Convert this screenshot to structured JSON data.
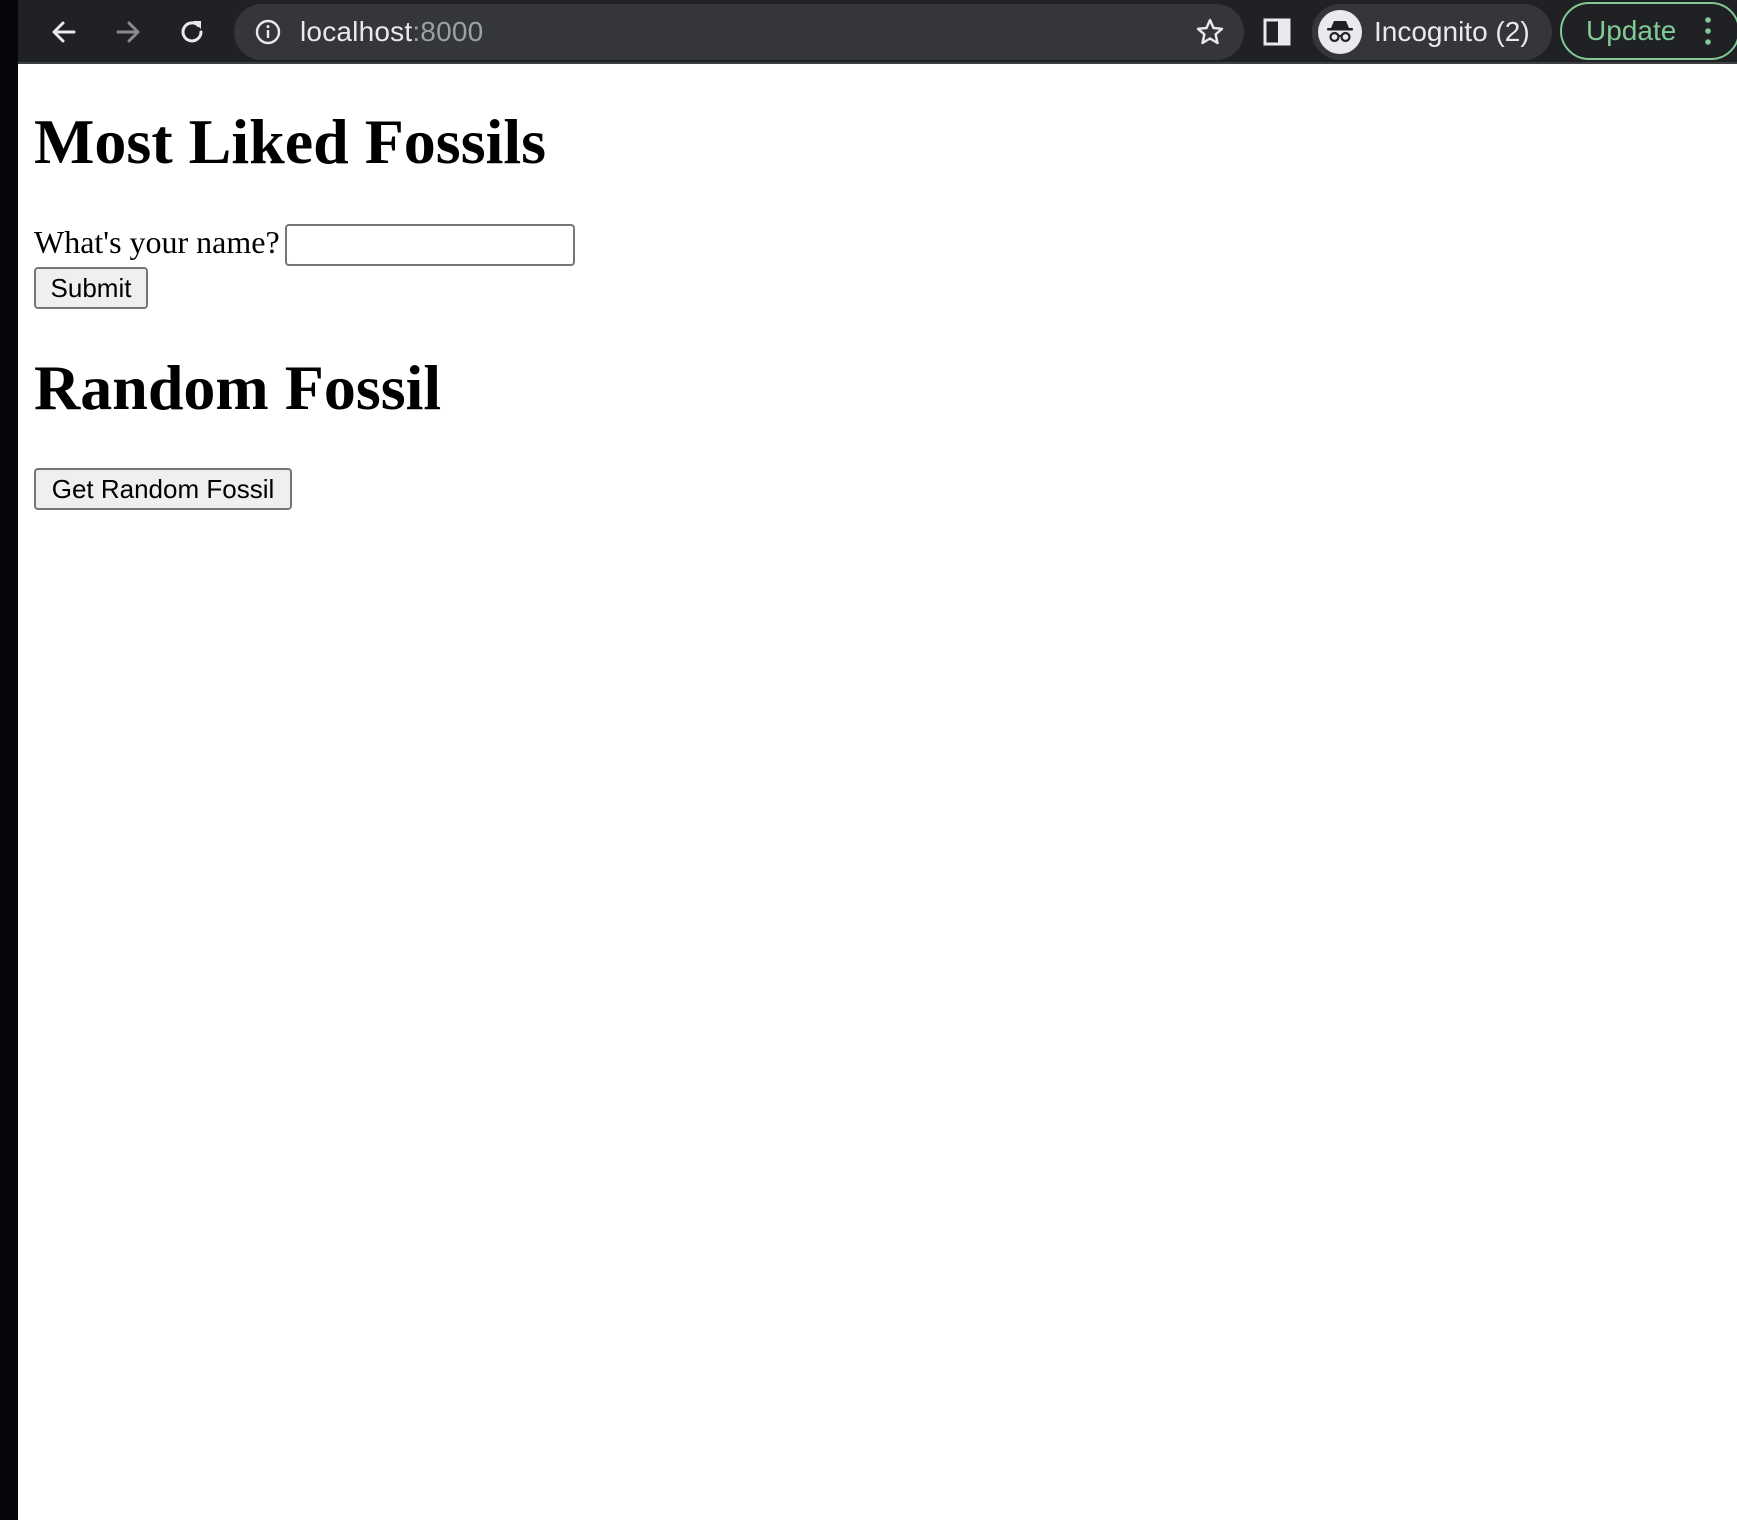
{
  "browser": {
    "url_host": "localhost",
    "url_port": ":8000",
    "profile_label": "Incognito (2)",
    "update_label": "Update",
    "icons": [
      "back-arrow-icon",
      "forward-arrow-icon",
      "reload-icon",
      "info-icon",
      "star-icon",
      "side-panel-icon",
      "incognito-icon",
      "kebab-menu-icon"
    ],
    "colors": {
      "toolbar": "#202124",
      "omnibox": "#35363a",
      "update_accent": "#81c995"
    }
  },
  "page": {
    "heading_fossils": "Most Liked Fossils",
    "name_label": "What's your name?",
    "name_value": "",
    "submit_label": "Submit",
    "heading_random": "Random Fossil",
    "random_button_label": "Get Random Fossil"
  }
}
